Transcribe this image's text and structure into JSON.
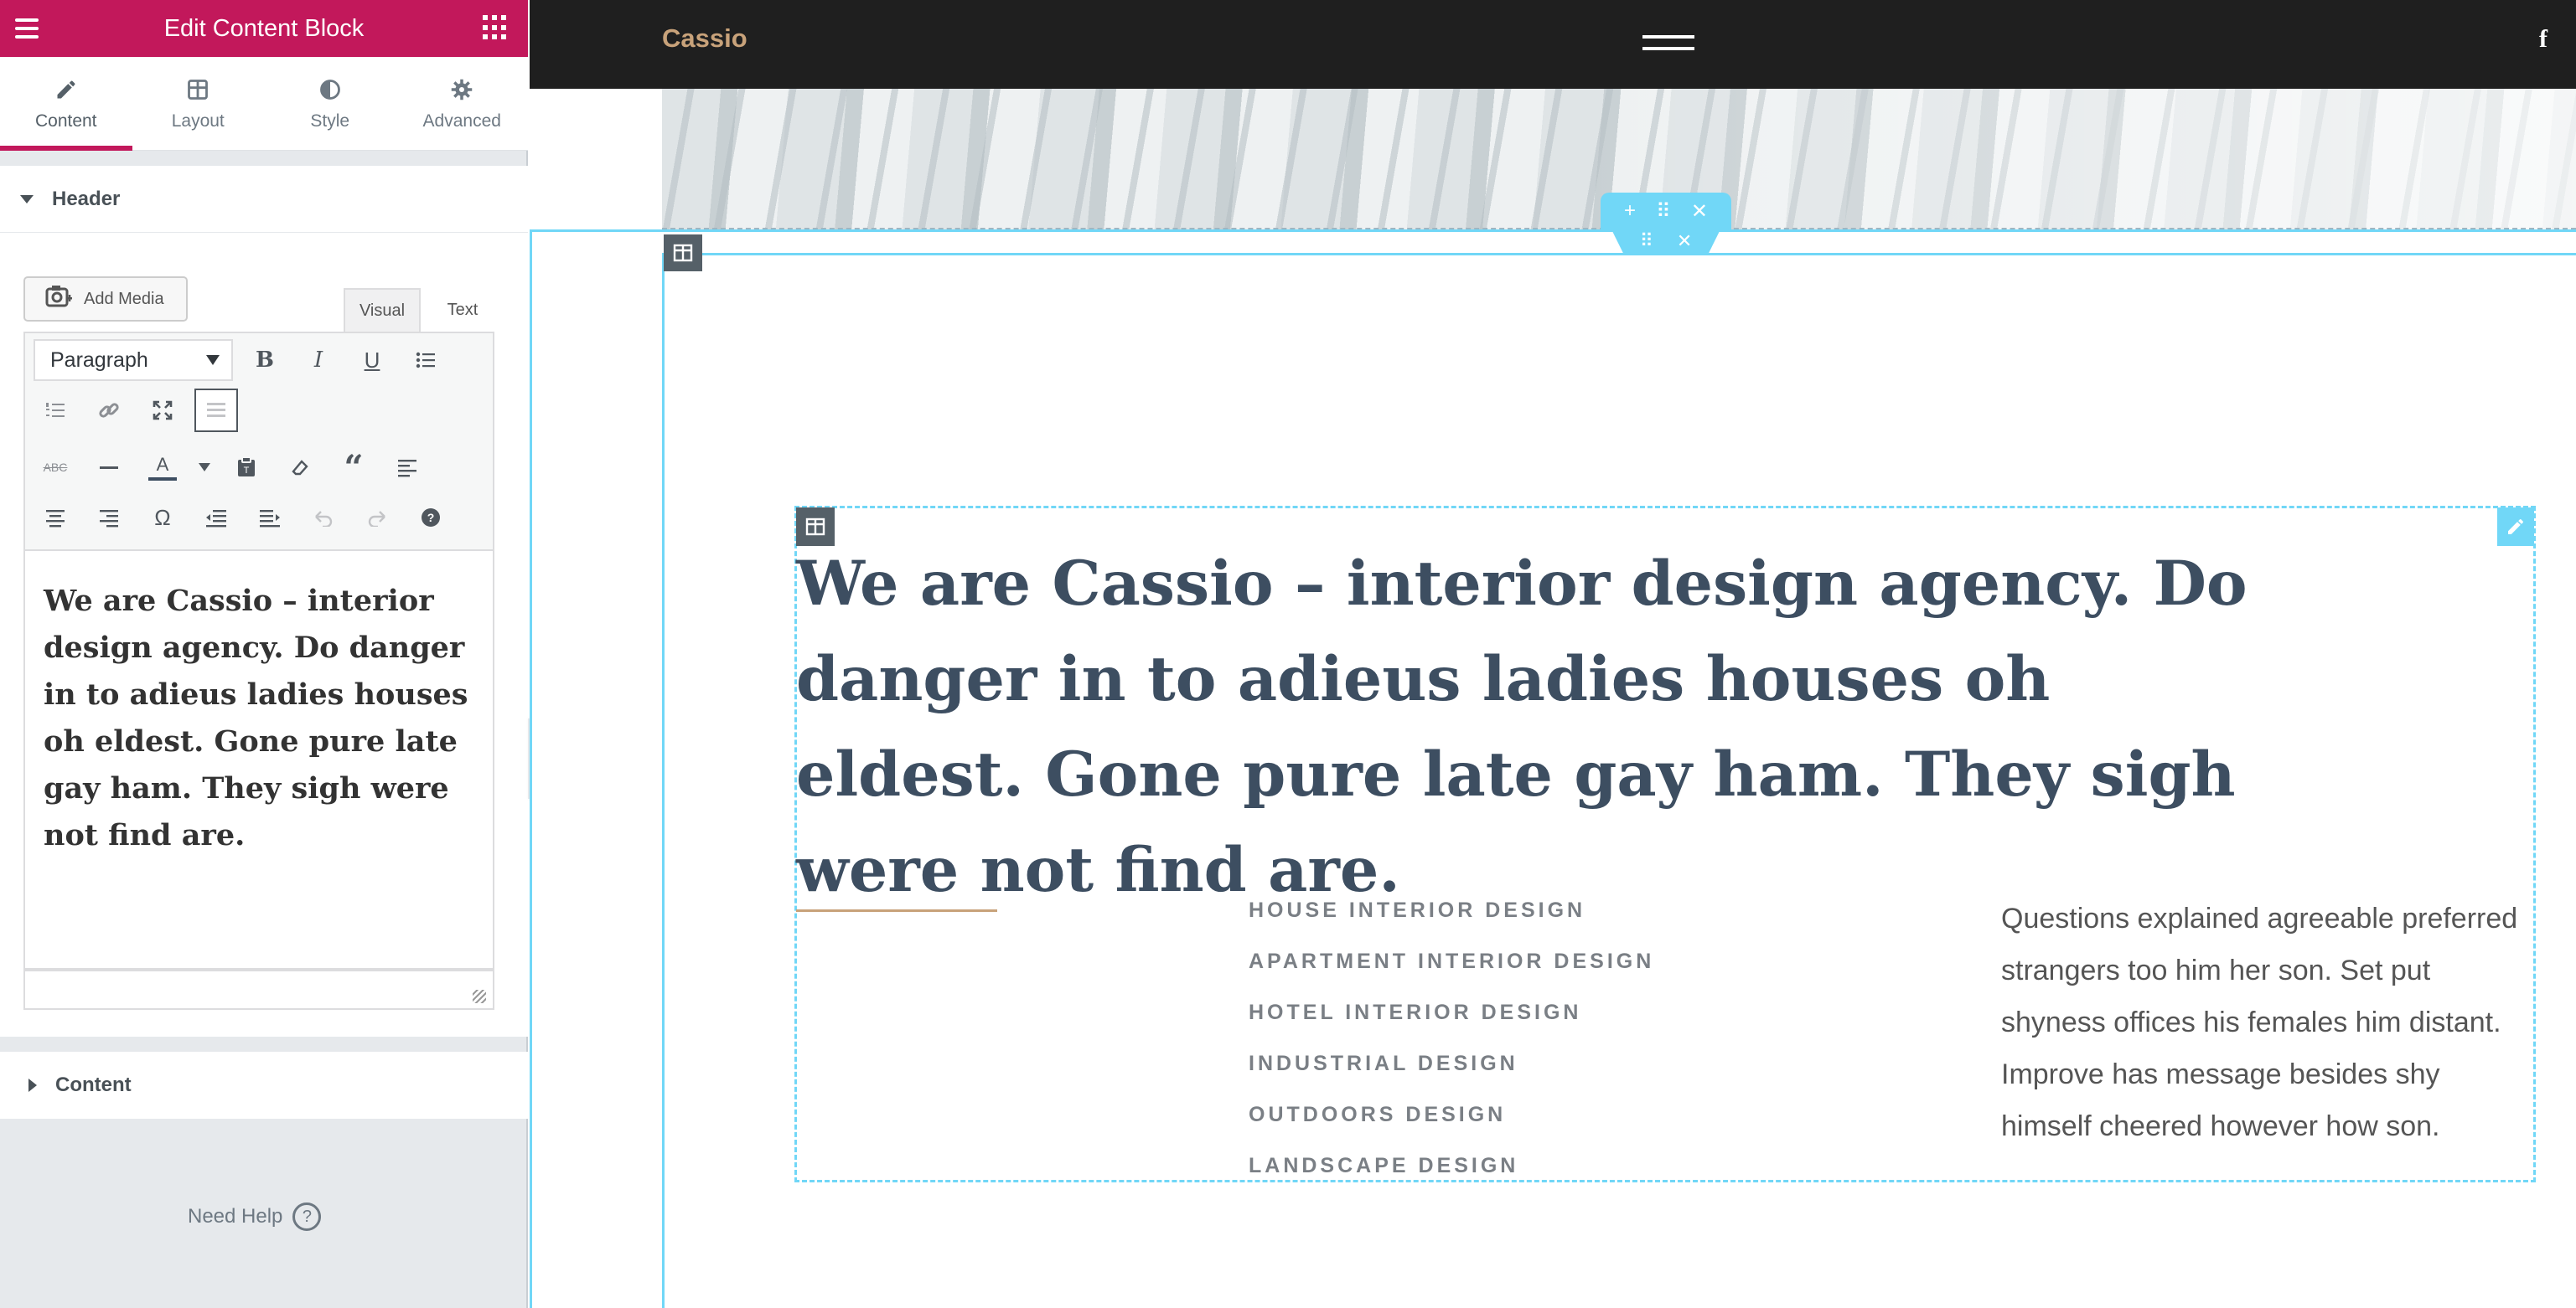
{
  "panel": {
    "title": "Edit Content Block",
    "tabs": [
      {
        "label": "Content",
        "icon": "pencil-icon",
        "active": true
      },
      {
        "label": "Layout",
        "icon": "layout-icon",
        "active": false
      },
      {
        "label": "Style",
        "icon": "contrast-icon",
        "active": false
      },
      {
        "label": "Advanced",
        "icon": "gear-icon",
        "active": false
      }
    ],
    "section_header": "Header",
    "section_content": "Content",
    "add_media_label": "Add Media",
    "mode_visual": "Visual",
    "mode_text": "Text",
    "format_select": "Paragraph",
    "editor_text": "We are Cassio – interior design agency. Do danger in to adieus ladies houses oh eldest. Gone pure late gay ham. They sigh were not find are.",
    "need_help": "Need Help",
    "accent_color": "#c2185b"
  },
  "toolbar": {
    "row1": [
      "bold-icon",
      "italic-icon",
      "underline-icon",
      "bullet-list-icon"
    ],
    "row2": [
      "numbered-list-icon",
      "link-icon",
      "fullscreen-icon",
      "toolbar-toggle-icon"
    ],
    "row3": [
      "strikethrough-icon",
      "horizontal-line-icon",
      "text-color-icon",
      "paste-text-icon",
      "clear-format-icon",
      "blockquote-icon",
      "align-left-icon"
    ],
    "row4": [
      "align-center-icon",
      "align-right-icon",
      "special-char-icon",
      "outdent-icon",
      "indent-icon",
      "undo-icon",
      "redo-icon",
      "help-icon"
    ]
  },
  "site": {
    "logo": "Cassio",
    "logo_color": "#c8a27a",
    "social_icon": "facebook-icon",
    "headline": "We are Cassio – interior design agency. Do danger in to adieus ladies houses oh eldest. Gone pure late gay ham. They sigh were not find are.",
    "services": [
      "HOUSE INTERIOR DESIGN",
      "APARTMENT INTERIOR DESIGN",
      "HOTEL INTERIOR DESIGN",
      "INDUSTRIAL DESIGN",
      "OUTDOORS DESIGN",
      "LANDSCAPE DESIGN"
    ],
    "side_text": "Questions explained agreeable preferred strangers too him her son. Set put shyness offices his females him distant. Improve has message besides shy himself cheered however how son.",
    "editor_outline_color": "#71d7f7"
  }
}
